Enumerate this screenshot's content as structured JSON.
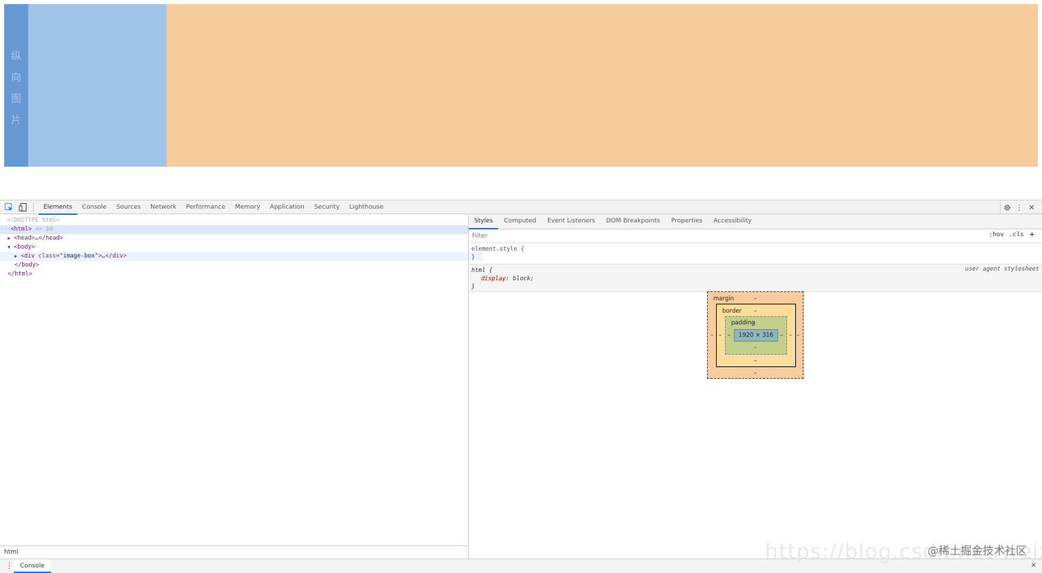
{
  "preview": {
    "vertical_chars": [
      "纵",
      "向",
      "图",
      "片"
    ],
    "colors": {
      "dark_blue": "#6699d4",
      "light_blue": "#9fc4e8",
      "orange": "#f6cc9c"
    }
  },
  "toolbar": {
    "tabs": [
      "Elements",
      "Console",
      "Sources",
      "Network",
      "Performance",
      "Memory",
      "Application",
      "Security",
      "Lighthouse"
    ],
    "active_tab": "Elements"
  },
  "elements": {
    "doctype": "<!DOCTYPE html>",
    "html_open": "html",
    "html_selected_suffix": "== $0",
    "head": "head",
    "head_ellipsis": "…",
    "body": "body",
    "div_tag": "div",
    "div_attr": "class",
    "div_value": "\"image-box\"",
    "body_close": "body",
    "html_close": "html"
  },
  "breadcrumb": "html",
  "styles": {
    "tabs": [
      "Styles",
      "Computed",
      "Event Listeners",
      "DOM Breakpoints",
      "Properties",
      "Accessibility"
    ],
    "active_tab": "Styles",
    "filter_placeholder": "Filter",
    "hov_label": ":hov",
    "cls_label": ".cls",
    "add_label": "+",
    "element_style_selector": "element.style {",
    "close_brace": "}",
    "html_selector": "html {",
    "user_agent": "user agent stylesheet",
    "prop_name": "display",
    "prop_value": "block;"
  },
  "box_model": {
    "margin_label": "margin",
    "border_label": "border",
    "padding_label": "padding",
    "dash": "–",
    "content_size": "1920 × 316"
  },
  "drawer": {
    "tab": "Console"
  },
  "watermark": "@稀土掘金技术社区",
  "watermark_url": "https://blog.csdn.net/weixin_"
}
